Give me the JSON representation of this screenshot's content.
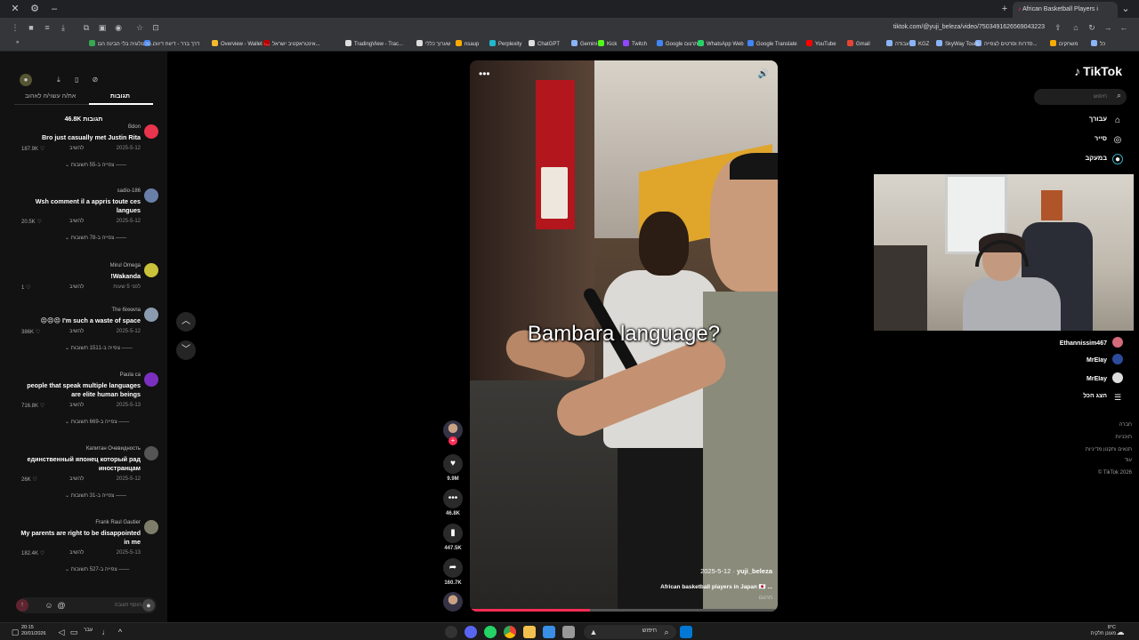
{
  "browser": {
    "tab_title": "African Basketball Players i",
    "url": "tiktok.com/@yuji_beleza/video/7503491626569043223",
    "bookmarks": [
      {
        "label": "כל",
        "color": "#8ab4f8"
      },
      {
        "label": "משחקים",
        "color": "#f9ab00"
      },
      {
        "label": "סדרות וסרטים לצפייה...",
        "color": "#8ab4f8"
      },
      {
        "label": "SkyWay Tours",
        "color": "#8ab4f8"
      },
      {
        "label": "KGZ",
        "color": "#8ab4f8"
      },
      {
        "label": "עבודה",
        "color": "#8ab4f8"
      },
      {
        "label": "Gmail",
        "color": "#ea4335"
      },
      {
        "label": "YouTube",
        "color": "#ff0000"
      },
      {
        "label": "Google Translate",
        "color": "#4285f4"
      },
      {
        "label": "WhatsApp Web",
        "color": "#25d366"
      },
      {
        "label": "Google תרגום",
        "color": "#4285f4"
      },
      {
        "label": "Twitch",
        "color": "#9146ff"
      },
      {
        "label": "Kick",
        "color": "#53fc18"
      },
      {
        "label": "Gemini",
        "color": "#8ab4f8"
      },
      {
        "label": "ChatGPT",
        "color": "#dddddd"
      },
      {
        "label": "Perplexity",
        "color": "#20b8cd"
      },
      {
        "label": "nsaup",
        "color": "#f9ab00"
      },
      {
        "label": "שערוך כללי",
        "color": "#dddddd"
      },
      {
        "label": "TradingView - Trac...",
        "color": "#dddddd"
      },
      {
        "label": "אינטראקטיב ישראל...",
        "color": "#c00000"
      },
      {
        "label": "Overview - Wallet -...",
        "color": "#f3ba2f"
      },
      {
        "label": "דרך ברר - דיווח דיווח",
        "color": "#4285f4"
      },
      {
        "label": "טכנולוגיה בלי הבינה הם...",
        "color": "#34a853"
      }
    ]
  },
  "comments_panel": {
    "tabs": [
      "תגובות",
      "את/ה עשוי/ה לאהוב"
    ],
    "total": "46.8K תגובות",
    "input_placeholder": "הוסף תגובה...",
    "comments": [
      {
        "user": "Bdon",
        "text": "Bro just casually met Justin Rita",
        "likes": "187.9K",
        "reply": "להשיב",
        "date": "2025-5-12",
        "replies": "צפייה ב-55 תשובות",
        "avatar": "#e8344c"
      },
      {
        "user": "sadio-186",
        "text": "Wsh comment il a appris toute ces langues",
        "likes": "20.5K",
        "reply": "להשיב",
        "date": "2025-5-12",
        "replies": "צפייה ב-78 תשובות",
        "avatar": "#6a7fa8"
      },
      {
        "user": "Mirul Omega",
        "text": "!Wakanda",
        "likes": "1",
        "reply": "להשיב",
        "date": "לפני 5 שעות",
        "replies": "",
        "avatar": "#c9c23a"
      },
      {
        "user": "The 6ixкила",
        "text": "😣😣😣 I'm such a waste of space",
        "likes": "386K",
        "reply": "להשיב",
        "date": "2025-5-12",
        "replies": "צפייה ב-1511 תשובות",
        "avatar": "#8a9bb0"
      },
      {
        "user": "Paula ca",
        "text": "people that speak multiple languages are elite human beings",
        "likes": "716.8K",
        "reply": "להשיב",
        "date": "2025-5-13",
        "replies": "צפייה ב-669 תשובות",
        "avatar": "#7b2fbe"
      },
      {
        "user": "Капитан Очевидность",
        "text": "единственный японец который рад иностранцам",
        "likes": "26K",
        "reply": "להשיב",
        "date": "2025-5-12",
        "replies": "צפייה ב-31 תשובות",
        "avatar": "#555555"
      },
      {
        "user": "Frank Raul Gautier",
        "text": "My parents are right to be disappointed in me",
        "likes": "182.4K",
        "reply": "להשיב",
        "date": "2025-5-13",
        "replies": "צפייה ב-527 תשובות",
        "avatar": "#7d7d6a"
      }
    ]
  },
  "video": {
    "caption": "Bambara language?",
    "date": "2025-5-12",
    "author": "yuji_beleza",
    "description": "African basketball players in Japan 🇯🇵 ...",
    "translate": "תרגום",
    "progress_fraction": 0.39
  },
  "actions": {
    "likes": "9.9M",
    "comments": "46.8K",
    "saves": "447.5K",
    "shares": "160.7K"
  },
  "sidebar": {
    "logo": "TikTok",
    "search_placeholder": "חיפוש",
    "nav": [
      "עבורך",
      "סייר",
      "במעקב"
    ],
    "following": [
      {
        "name": "Ethannissim467",
        "color": "#d46a7a"
      },
      {
        "name": "MrEIay",
        "color": "#2b4c9b"
      },
      {
        "name": "MrEIay",
        "color": "#dddddd"
      }
    ],
    "show_all": "הצג הכל",
    "footer": [
      "חברה",
      "תוכניות",
      "תנאים ותקנון מדיניות",
      "עוד",
      "© TikTok 2026"
    ]
  },
  "taskbar": {
    "time": "20:15",
    "date": "20/01/2026",
    "lang": "עבר",
    "search": "חיפוש",
    "weather_temp": "8°C",
    "weather_text": "מעונן חלקית"
  }
}
